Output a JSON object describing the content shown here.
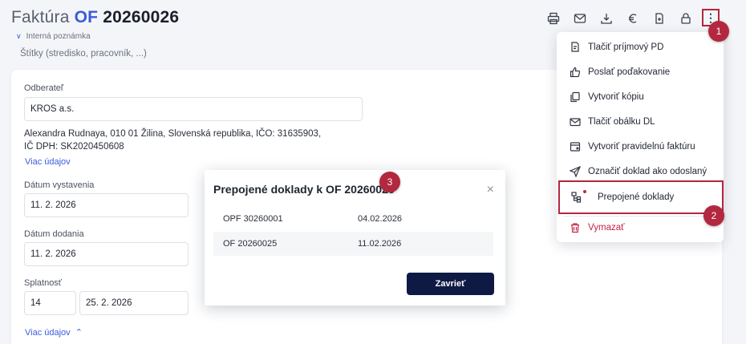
{
  "header": {
    "title_prefix": "Faktúra",
    "title_of": "OF",
    "title_number": "20260026",
    "internal_note_label": "Interná poznámka",
    "tags_placeholder": "Štítky (stredisko, pracovník, ...)"
  },
  "toolbar": {
    "icons": [
      "printer-icon",
      "mail-icon",
      "download-icon",
      "euro-icon",
      "convert-icon",
      "lock-icon",
      "more-vertical-icon"
    ],
    "more_label": "⋮"
  },
  "form": {
    "customer_label": "Odberateľ",
    "customer_value": "KROS a.s.",
    "address_line1": "Alexandra Rudnaya, 010 01 Žilina, Slovenská republika, IČO: 31635903,",
    "address_line2": "IČ DPH: SK2020450608",
    "more_info_link": "Viac údajov",
    "issue_date_label": "Dátum vystavenia",
    "issue_date_value": "11. 2. 2026",
    "delivery_date_label": "Dátum dodania",
    "delivery_date_value": "11. 2. 2026",
    "due_label": "Splatnosť",
    "due_days_value": "14",
    "due_date_value": "25. 2. 2026",
    "more_info_link_2": "Viac údajov"
  },
  "menu": {
    "items": [
      {
        "label": "Tlačiť príjmový PD",
        "icon": "receipt-print-icon"
      },
      {
        "label": "Poslať poďakovanie",
        "icon": "thumbs-up-icon"
      },
      {
        "label": "Vytvoriť kópiu",
        "icon": "copy-document-icon"
      },
      {
        "label": "Tlačiť obálku DL",
        "icon": "envelope-print-icon"
      },
      {
        "label": "Vytvoriť pravidelnú faktúru",
        "icon": "recurring-invoice-icon"
      },
      {
        "label": "Označiť doklad ako odoslaný",
        "icon": "send-icon"
      },
      {
        "label": "Prepojené doklady",
        "icon": "linked-documents-icon"
      },
      {
        "label": "Vymazať",
        "icon": "trash-icon"
      }
    ]
  },
  "dialog": {
    "title": "Prepojené doklady k OF 20260026",
    "close_label": "×",
    "rows": [
      {
        "doc": "OPF 30260001",
        "date": "04.02.2026"
      },
      {
        "doc": "OF 20260025",
        "date": "11.02.2026"
      }
    ],
    "close_button": "Zavrieť"
  },
  "badges": {
    "b1": "1",
    "b2": "2",
    "b3": "3"
  },
  "colors": {
    "accent": "#3b5bdb",
    "highlight": "#b3273f",
    "danger": "#c2254a",
    "primary_button": "#0f1a44"
  }
}
